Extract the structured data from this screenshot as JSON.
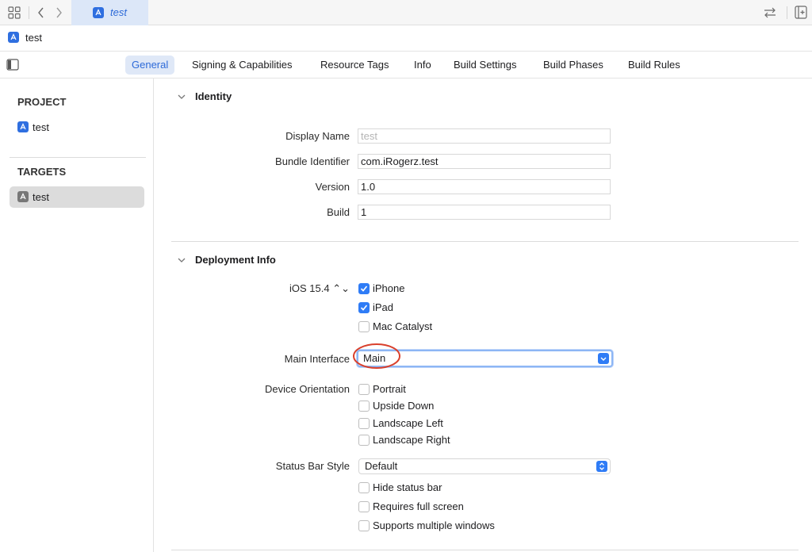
{
  "window": {
    "tab_title": "test",
    "project_name": "test"
  },
  "tabs": [
    "General",
    "Signing & Capabilities",
    "Resource Tags",
    "Info",
    "Build Settings",
    "Build Phases",
    "Build Rules"
  ],
  "active_tab": "General",
  "sidebar": {
    "project_header": "PROJECT",
    "project_item": "test",
    "targets_header": "TARGETS",
    "target_item": "test"
  },
  "identity": {
    "title": "Identity",
    "display_name_label": "Display Name",
    "display_name_placeholder": "test",
    "bundle_id_label": "Bundle Identifier",
    "bundle_id_value": "com.iRogerz.test",
    "version_label": "Version",
    "version_value": "1.0",
    "build_label": "Build",
    "build_value": "1"
  },
  "deployment": {
    "title": "Deployment Info",
    "ios_version": "iOS 15.4 ⌃⌄",
    "devices": [
      {
        "label": "iPhone",
        "checked": true
      },
      {
        "label": "iPad",
        "checked": true
      },
      {
        "label": "Mac Catalyst",
        "checked": false
      }
    ],
    "main_interface_label": "Main Interface",
    "main_interface_value": "Main",
    "orientation_label": "Device Orientation",
    "orientations": [
      {
        "label": "Portrait",
        "checked": false
      },
      {
        "label": "Upside Down",
        "checked": false
      },
      {
        "label": "Landscape Left",
        "checked": false
      },
      {
        "label": "Landscape Right",
        "checked": false
      }
    ],
    "status_bar_label": "Status Bar Style",
    "status_bar_value": "Default",
    "status_options": [
      {
        "label": "Hide status bar",
        "checked": false
      },
      {
        "label": "Requires full screen",
        "checked": false
      },
      {
        "label": "Supports multiple windows",
        "checked": false
      }
    ]
  },
  "colors": {
    "accent": "#2f7cf6",
    "annotation": "#d9402c"
  }
}
